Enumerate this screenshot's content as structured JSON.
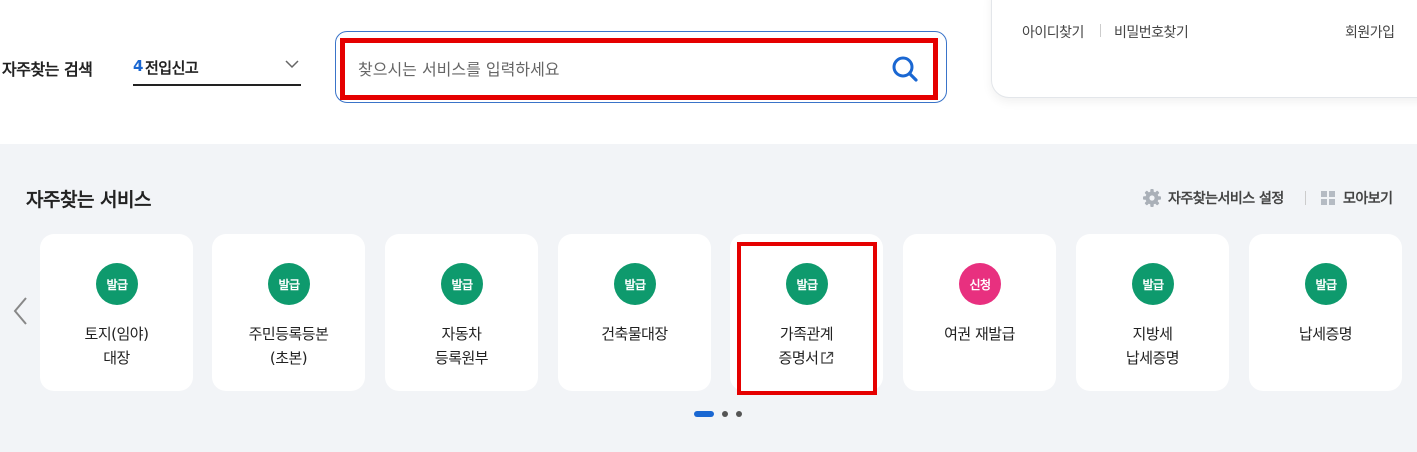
{
  "search_area": {
    "frequent_label": "자주찾는 검색",
    "keyword_rank": "4",
    "keyword_text": "전입신고",
    "placeholder": "찾으시는 서비스를 입력하세요"
  },
  "login_panel": {
    "find_id": "아이디찾기",
    "find_password": "비밀번호찾기",
    "signup": "회원가입"
  },
  "services": {
    "title": "자주찾는 서비스",
    "settings_label": "자주찾는서비스 설정",
    "view_all_label": "모아보기",
    "cards": [
      {
        "badge": "발급",
        "badge_color": "#0e9a6d",
        "line1": "토지(임야)",
        "line2": "대장"
      },
      {
        "badge": "발급",
        "badge_color": "#0e9a6d",
        "line1": "주민등록등본",
        "line2": "(초본)"
      },
      {
        "badge": "발급",
        "badge_color": "#0e9a6d",
        "line1": "자동차",
        "line2": "등록원부"
      },
      {
        "badge": "발급",
        "badge_color": "#0e9a6d",
        "line1": "건축물대장",
        "line2": ""
      },
      {
        "badge": "발급",
        "badge_color": "#0e9a6d",
        "line1": "가족관계",
        "line2": "증명서",
        "external_link": true
      },
      {
        "badge": "신청",
        "badge_color": "#e8307f",
        "line1": "여권 재발급",
        "line2": ""
      },
      {
        "badge": "발급",
        "badge_color": "#0e9a6d",
        "line1": "지방세",
        "line2": "납세증명"
      },
      {
        "badge": "발급",
        "badge_color": "#0e9a6d",
        "line1": "납세증명",
        "line2": ""
      }
    ],
    "pagination": {
      "pages": 3,
      "current": 1
    }
  },
  "colors": {
    "accent": "#1a67d2",
    "highlight": "#e50000",
    "background": "#f2f4f7"
  }
}
